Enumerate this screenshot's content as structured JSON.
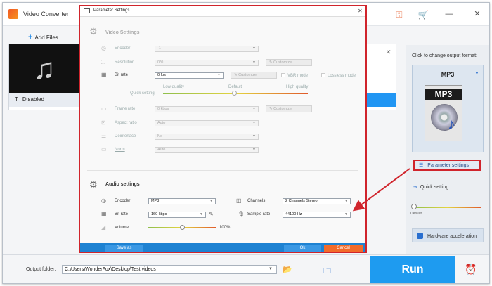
{
  "app": {
    "title": "Video Converter",
    "add_files": "Add Files",
    "subtitle_state": "Disabled",
    "run": "Run",
    "output_folder_label": "Output folder:",
    "output_folder_value": "C:\\Users\\WonderFox\\Desktop\\Test videos"
  },
  "right_panel": {
    "change_format_label": "Click to change output format:",
    "format": "MP3",
    "format_icon_text": "MP3",
    "parameter_settings": "Parameter settings",
    "quick_setting": "Quick setting",
    "slider_default": "Default",
    "hardware_acceleration": "Hardware acceleration"
  },
  "dialog": {
    "title": "Parameter Settings",
    "video_section": {
      "heading": "Video Settings",
      "encoder_label": "Encoder",
      "encoder_value": "-1",
      "resolution_label": "Resolution",
      "resolution_value": "0*0",
      "customize": "Customize",
      "bitrate_label": "Bit rate",
      "bitrate_value": "0 fps",
      "vbr_mode": "VBR mode",
      "lossless_mode": "Lossless mode",
      "quick_setting_label": "Quick setting",
      "low_quality": "Low quality",
      "default": "Default",
      "high_quality": "High quality",
      "frame_rate_label": "Frame rate",
      "frame_rate_value": "0 kbps",
      "aspect_ratio_label": "Aspect ratio",
      "aspect_ratio_value": "Auto",
      "deinterlace_label": "Deinterlace",
      "deinterlace_value": "No",
      "norm_label": "Norm",
      "norm_value": "Auto"
    },
    "audio_section": {
      "heading": "Audio settings",
      "encoder_label": "Encoder",
      "encoder_value": "MP3",
      "channels_label": "Channels",
      "channels_value": "2 Channels Stereo",
      "bitrate_label": "Bit rate",
      "bitrate_value": "160 kbps",
      "sample_rate_label": "Sample rate",
      "sample_rate_value": "44100 Hz",
      "volume_label": "Volume",
      "volume_value": "100%",
      "volume_level": 0.5
    },
    "save_as": "Save as",
    "ok": "Ok",
    "cancel": "Cancel"
  },
  "colors": {
    "accent": "#1e9bf0",
    "highlight_border": "#d0242c",
    "cancel": "#f26b2a"
  }
}
